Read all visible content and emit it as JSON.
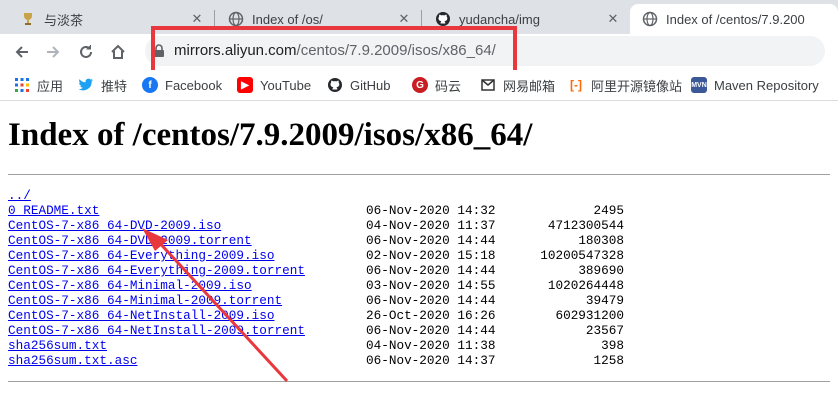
{
  "browser": {
    "tabs": [
      {
        "title": "与淡茶",
        "icon": "trophy-icon",
        "active": false
      },
      {
        "title": "Index of /os/",
        "icon": "globe-icon",
        "active": false
      },
      {
        "title": "yudancha/img",
        "icon": "github-icon",
        "active": false
      },
      {
        "title": "Index of /centos/7.9.200",
        "icon": "globe-icon",
        "active": true
      }
    ],
    "url": {
      "host": "mirrors.aliyun.com",
      "path": "/centos/7.9.2009/isos/x86_64/"
    },
    "bookmarks": [
      {
        "label": "应用",
        "icon": "apps-grid-icon"
      },
      {
        "label": "推特",
        "icon": "twitter-icon"
      },
      {
        "label": "Facebook",
        "icon": "facebook-icon"
      },
      {
        "label": "YouTube",
        "icon": "youtube-icon"
      },
      {
        "label": "GitHub",
        "icon": "github-icon"
      },
      {
        "label": "码云",
        "icon": "gitee-icon"
      },
      {
        "label": "网易邮箱",
        "icon": "netease-mail-icon"
      },
      {
        "label": "阿里开源镜像站",
        "icon": "aliyun-icon"
      },
      {
        "label": "Maven Repository",
        "icon": "mvn-icon"
      }
    ]
  },
  "page": {
    "heading": "Index of /centos/7.9.2009/isos/x86_64/",
    "parent_link": "../",
    "files": [
      {
        "name": "0_README.txt",
        "date": "06-Nov-2020 14:32",
        "size": "2495"
      },
      {
        "name": "CentOS-7-x86_64-DVD-2009.iso",
        "date": "04-Nov-2020 11:37",
        "size": "4712300544"
      },
      {
        "name": "CentOS-7-x86_64-DVD-2009.torrent",
        "date": "06-Nov-2020 14:44",
        "size": "180308"
      },
      {
        "name": "CentOS-7-x86_64-Everything-2009.iso",
        "date": "02-Nov-2020 15:18",
        "size": "10200547328"
      },
      {
        "name": "CentOS-7-x86_64-Everything-2009.torrent",
        "date": "06-Nov-2020 14:44",
        "size": "389690"
      },
      {
        "name": "CentOS-7-x86_64-Minimal-2009.iso",
        "date": "03-Nov-2020 14:55",
        "size": "1020264448"
      },
      {
        "name": "CentOS-7-x86_64-Minimal-2009.torrent",
        "date": "06-Nov-2020 14:44",
        "size": "39479"
      },
      {
        "name": "CentOS-7-x86_64-NetInstall-2009.iso",
        "date": "26-Oct-2020 16:26",
        "size": "602931200"
      },
      {
        "name": "CentOS-7-x86_64-NetInstall-2009.torrent",
        "date": "06-Nov-2020 14:44",
        "size": "23567"
      },
      {
        "name": "sha256sum.txt",
        "date": "04-Nov-2020 11:38",
        "size": "398"
      },
      {
        "name": "sha256sum.txt.asc",
        "date": "06-Nov-2020 14:37",
        "size": "1258"
      }
    ]
  },
  "annotation": {
    "color": "#e8383d"
  }
}
